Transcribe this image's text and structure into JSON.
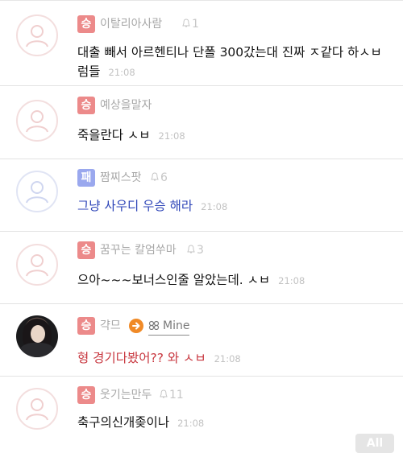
{
  "comments": [
    {
      "badge": "승",
      "nick": "이탈리아사람",
      "likes": "1",
      "text": "대출 빼서 아르헨티나 단폴 300갔는대 진짜 ㅈ같다 하ㅅㅂ럼들",
      "time": "21:08"
    },
    {
      "badge": "승",
      "nick": "예상을말자",
      "likes": "",
      "text": "죽을란다 ㅅㅂ",
      "time": "21:08"
    },
    {
      "badge": "패",
      "nick": "짬찌스팟",
      "likes": "6",
      "text": "그냥 사우디 우승 해라",
      "time": "21:08"
    },
    {
      "badge": "승",
      "nick": "꿈꾸는 칼엄쑤마",
      "likes": "3",
      "text": "으아~~~보너스인줄 알았는데. ㅅㅂ",
      "time": "21:08"
    },
    {
      "badge": "승",
      "nick": "갹므",
      "likes": "",
      "mine": "Mine",
      "text": "형 경기다봤어?? 와 ㅅㅂ",
      "time": "21:08"
    },
    {
      "badge": "승",
      "nick": "웃기는만두",
      "likes": "11",
      "text": "축구의신개좆이나",
      "time": "21:08"
    }
  ],
  "all_button": "All",
  "colors": {
    "red_badge": "#ec8a8a",
    "blue_badge": "#9aa8ee",
    "accent_orange": "#f08a27",
    "blue_text": "#2f46b8",
    "red_text": "#c8373f"
  }
}
